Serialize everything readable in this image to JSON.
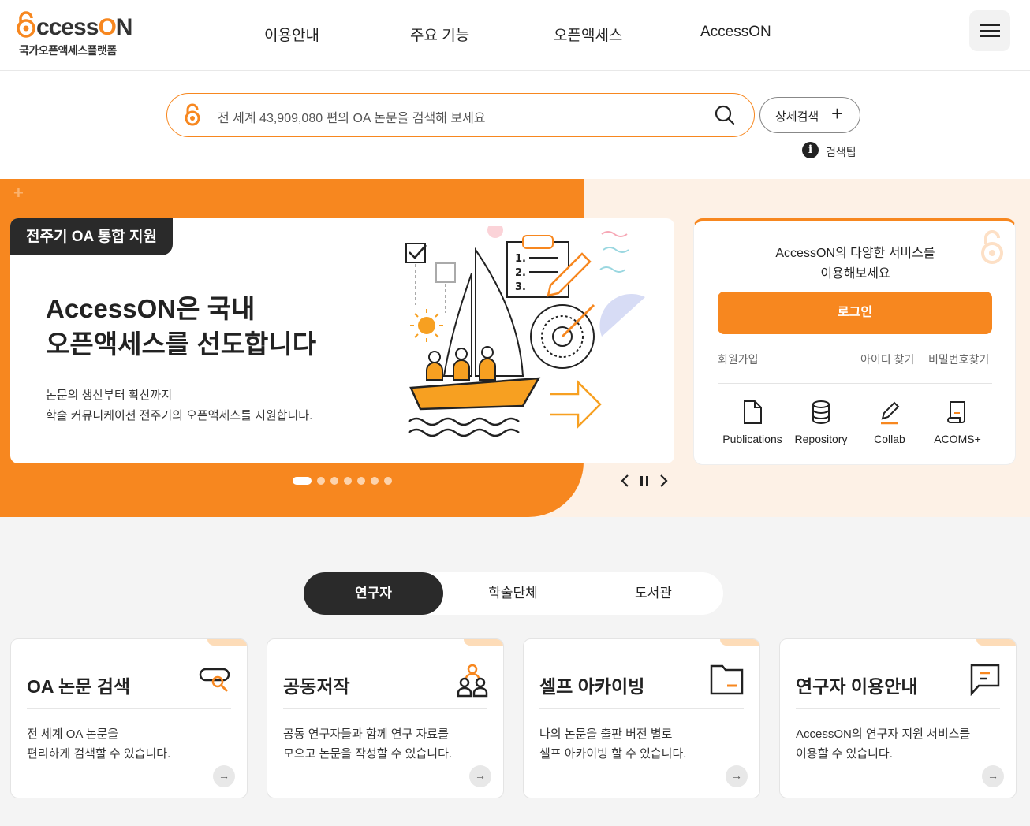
{
  "header": {
    "logo_text": "AccessON",
    "logo_sub": "국가오픈액세스플랫폼",
    "nav": [
      "이용안내",
      "주요 기능",
      "오픈액세스",
      "AccessON"
    ]
  },
  "search": {
    "placeholder": "전 세계 43,909,080 편의 OA 논문을 검색해 보세요",
    "advanced_label": "상세검색",
    "tip_label": "검색팁"
  },
  "hero": {
    "tag": "전주기 OA 통합 지원",
    "title_line1": "AccessON은 국내",
    "title_line2": "오픈액세스를 선도합니다",
    "desc_line1": "논문의 생산부터 확산까지",
    "desc_line2": "학술 커뮤니케이션 전주기의 오픈액세스를 지원합니다.",
    "slide_count": 7,
    "active_slide": 1
  },
  "login": {
    "message_line1": "AccessON의 다양한 서비스를",
    "message_line2": "이용해보세요",
    "login_label": "로그인",
    "signup_label": "회원가입",
    "find_id_label": "아이디 찾기",
    "find_pw_label": "비밀번호찾기",
    "services": [
      {
        "label": "Publications",
        "icon": "document-icon"
      },
      {
        "label": "Repository",
        "icon": "database-icon"
      },
      {
        "label": "Collab",
        "icon": "pen-icon"
      },
      {
        "label": "ACOMS+",
        "icon": "scroll-icon"
      }
    ]
  },
  "tabs": [
    "연구자",
    "학술단체",
    "도서관"
  ],
  "active_tab": "연구자",
  "cards": [
    {
      "title": "OA 논문 검색",
      "desc_line1": "전 세계 OA 논문을",
      "desc_line2": "편리하게 검색할 수 있습니다.",
      "icon": "search-doc-icon"
    },
    {
      "title": "공동저작",
      "desc_line1": "공동 연구자들과 함께 연구 자료를",
      "desc_line2": "모으고 논문을 작성할 수 있습니다.",
      "icon": "people-icon"
    },
    {
      "title": "셀프 아카이빙",
      "desc_line1": "나의 논문을 출판 버전 별로",
      "desc_line2": "셀프 아카이빙 할 수 있습니다.",
      "icon": "folder-icon"
    },
    {
      "title": "연구자 이용안내",
      "desc_line1": "AccessON의 연구자 지원 서비스를",
      "desc_line2": "이용할 수 있습니다.",
      "icon": "chat-icon"
    }
  ],
  "colors": {
    "accent": "#f7871f",
    "dark": "#2a2a2a",
    "hero_bg": "#fdf1e6"
  }
}
